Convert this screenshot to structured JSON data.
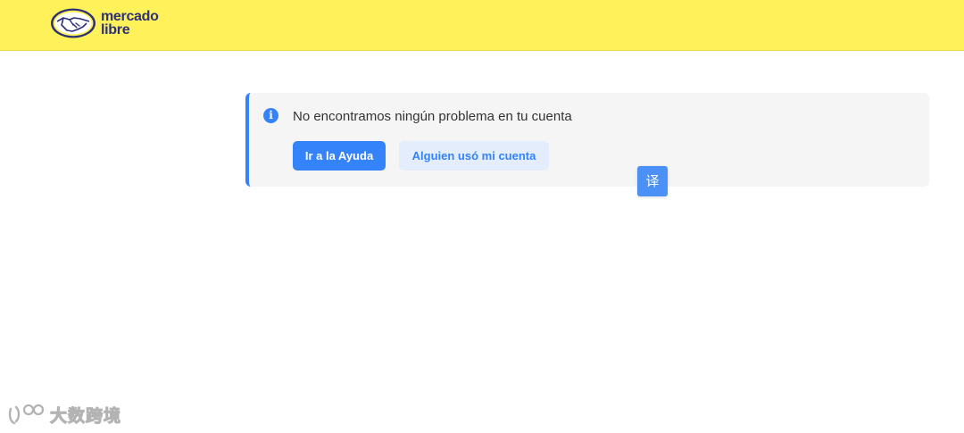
{
  "header": {
    "brand_line1": "mercado",
    "brand_line2": "libre",
    "bg_color": "#fff159",
    "brand_color": "#2d3277"
  },
  "notice": {
    "icon": "info-icon",
    "message": "No encontramos ningún problema en tu cuenta",
    "accent_color": "#3483fa",
    "primary_button": "Ir a la Ayuda",
    "secondary_button": "Alguien usó mi cuenta"
  },
  "overlay": {
    "translate_label": "译"
  },
  "watermark": {
    "text": "大数跨境"
  }
}
